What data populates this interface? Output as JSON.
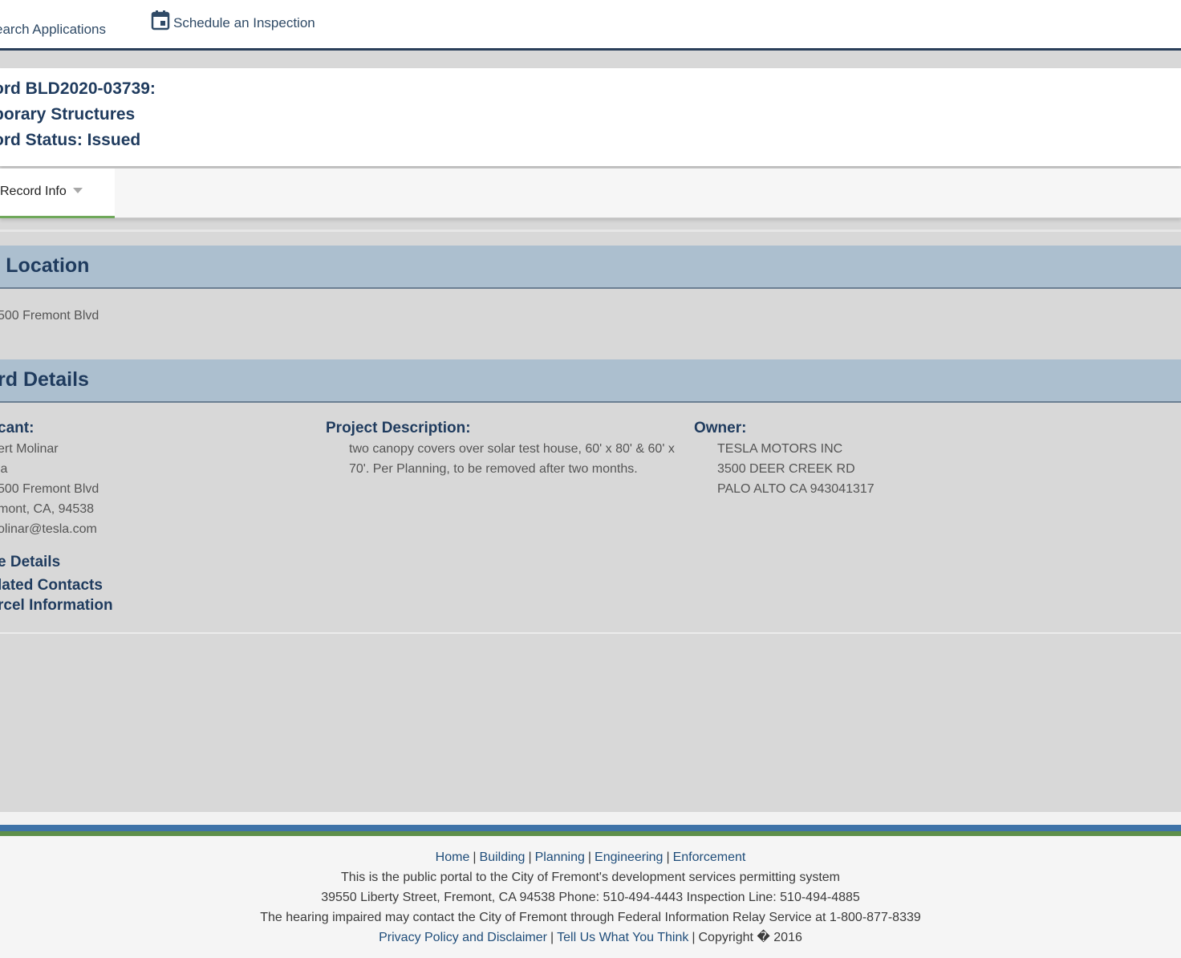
{
  "nav": {
    "search_label": "earch Applications",
    "schedule_label": "Schedule an Inspection"
  },
  "record_header": {
    "line1": "ord BLD2020-03739:",
    "line2": "porary Structures",
    "line3": "ord Status: Issued"
  },
  "tabs": {
    "record_info": "Record Info"
  },
  "work_location": {
    "title": "Location",
    "title_prefix": ":",
    "address": "500 Fremont Blvd"
  },
  "record_details": {
    "title": "rd Details",
    "applicant": {
      "label": "cant:",
      "lines": [
        "ert Molinar",
        "la",
        "500 Fremont Blvd",
        "mont, CA, 94538",
        "olinar@tesla.com"
      ]
    },
    "project_description": {
      "label": "Project Description:",
      "text": "two canopy covers over solar test house, 60' x 80' & 60' x 70'. Per Planning, to be removed after two months."
    },
    "owner": {
      "label": "Owner:",
      "lines": [
        "TESLA MOTORS INC",
        "3500 DEER CREEK RD",
        "PALO ALTO CA 943041317"
      ]
    },
    "links": {
      "more_details": "e Details",
      "related_contacts": "lated Contacts",
      "parcel_information": "rcel Information"
    }
  },
  "footer": {
    "links": [
      "Home",
      "Building",
      "Planning",
      "Engineering",
      "Enforcement"
    ],
    "line2": "This is the public portal to the City of Fremont's development services permitting system",
    "line3": "39550 Liberty Street, Fremont, CA 94538 Phone: 510-494-4443 Inspection Line: 510-494-4885",
    "line4": "The hearing impaired may contact the City of Fremont through Federal Information Relay Service at 1-800-877-8339",
    "privacy": "Privacy Policy and Disclaimer",
    "tell_us": "Tell Us What You Think",
    "copyright": "Copyright � 2016"
  },
  "colors": {
    "navy": "#1f3b5e",
    "section_bg": "#acbfcf",
    "tab_green": "#6fa85a",
    "footer_blue": "#3f73a8",
    "footer_green": "#5e8f4a"
  }
}
